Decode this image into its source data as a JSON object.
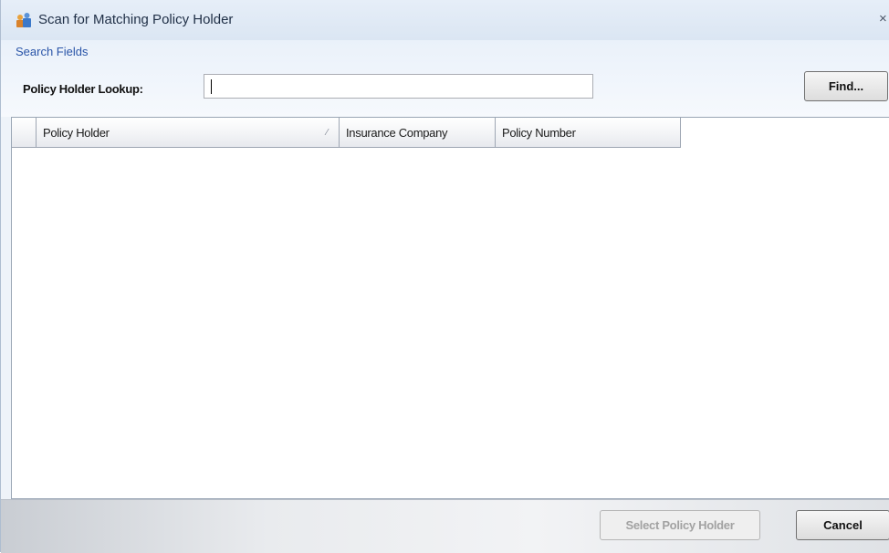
{
  "window": {
    "title": "Scan for Matching Policy Holder",
    "close_glyph": "×",
    "icon": "people-icon"
  },
  "search": {
    "group_label": "Search Fields",
    "lookup_label": "Policy Holder Lookup:",
    "lookup_value": "",
    "find_label": "Find..."
  },
  "grid": {
    "columns": [
      {
        "label": ""
      },
      {
        "label": "Policy Holder",
        "sort_glyph": "⁄"
      },
      {
        "label": "Insurance Company"
      },
      {
        "label": "Policy Number"
      }
    ],
    "rows": []
  },
  "footer": {
    "select_label": "Select Policy Holder",
    "select_enabled": false,
    "cancel_label": "Cancel"
  },
  "colors": {
    "title_bar": "#dbe6f3",
    "group_label": "#2a55a8",
    "disabled_text": "#a2a2a2"
  }
}
